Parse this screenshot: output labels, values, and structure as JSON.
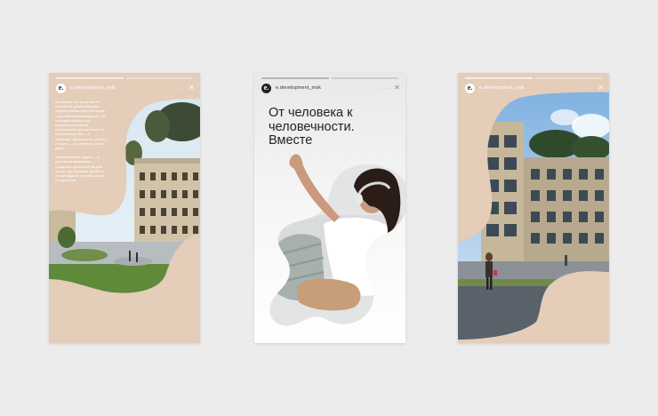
{
  "stories": [
    {
      "account": "e.development_msk",
      "logo": "e.",
      "more_label": "···",
      "close_label": "✕",
      "paragraphs": [
        "Мы знаем, что решение по стоимости дома выбирают люди в разных пространствах, с достаточным комфортом. Но в каждом проекте мы предлагаем равные возможности для жителей: от прогулочных зон — в общение, образование, работа и отдых — за клубных стенах дома.",
        "Наша ближнее задача — в душевном измерении — создавать пространства для жизни, где человеку удобно и это обладание чувства жизни в ощущение."
      ]
    },
    {
      "account": "e.development_msk",
      "logo": "e.",
      "more_label": "···",
      "close_label": "✕",
      "headline": "От человека к человечности. Вместе"
    },
    {
      "account": "e.development_msk",
      "logo": "e.",
      "more_label": "···",
      "close_label": "✕"
    }
  ],
  "colors": {
    "background": "#ececec",
    "beige": "#e4cdb9",
    "white": "#ffffff",
    "headline": "#222222"
  }
}
